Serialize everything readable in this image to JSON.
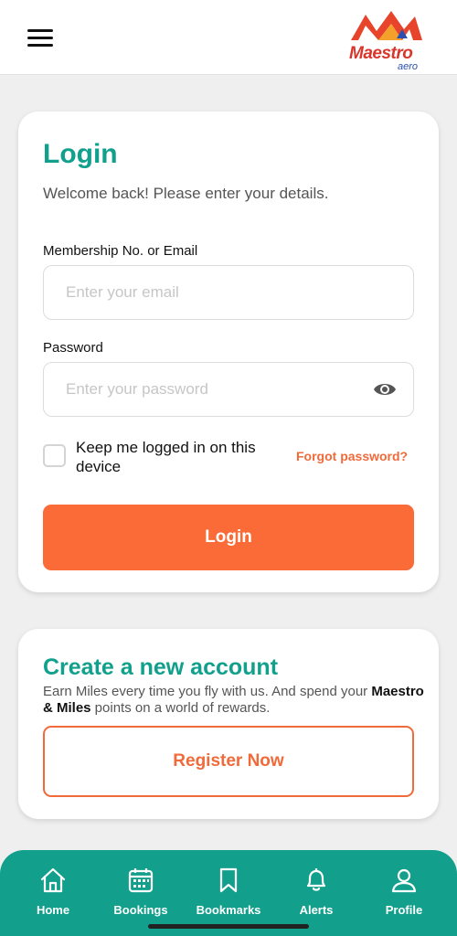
{
  "header": {
    "menu_icon": "hamburger-menu-icon",
    "logo_text": "Maestro",
    "logo_sub": "aero"
  },
  "login": {
    "title": "Login",
    "subtitle": "Welcome back! Please enter your details.",
    "email_label": "Membership No. or Email",
    "email_placeholder": "Enter your email",
    "email_value": "",
    "password_label": "Password",
    "password_placeholder": "Enter your password",
    "password_value": "",
    "keep_logged_in": "Keep me logged in on this device",
    "forgot_password": "Forgot password?",
    "login_button": "Login"
  },
  "register": {
    "title": "Create a new account",
    "desc_part1": "Earn Miles every time you fly with us. And spend your ",
    "desc_bold": "Maestro & Miles",
    "desc_part2": " points on a world of rewards.",
    "register_button": "Register Now"
  },
  "nav": {
    "items": [
      {
        "label": "Home",
        "icon": "home-icon"
      },
      {
        "label": "Bookings",
        "icon": "calendar-icon"
      },
      {
        "label": "Bookmarks",
        "icon": "bookmark-icon"
      },
      {
        "label": "Alerts",
        "icon": "bell-icon"
      },
      {
        "label": "Profile",
        "icon": "user-icon"
      }
    ]
  },
  "colors": {
    "accent": "#11a08c",
    "primary_button": "#fb6b37",
    "link": "#f06a3a",
    "nav_bg": "#12a08c"
  }
}
